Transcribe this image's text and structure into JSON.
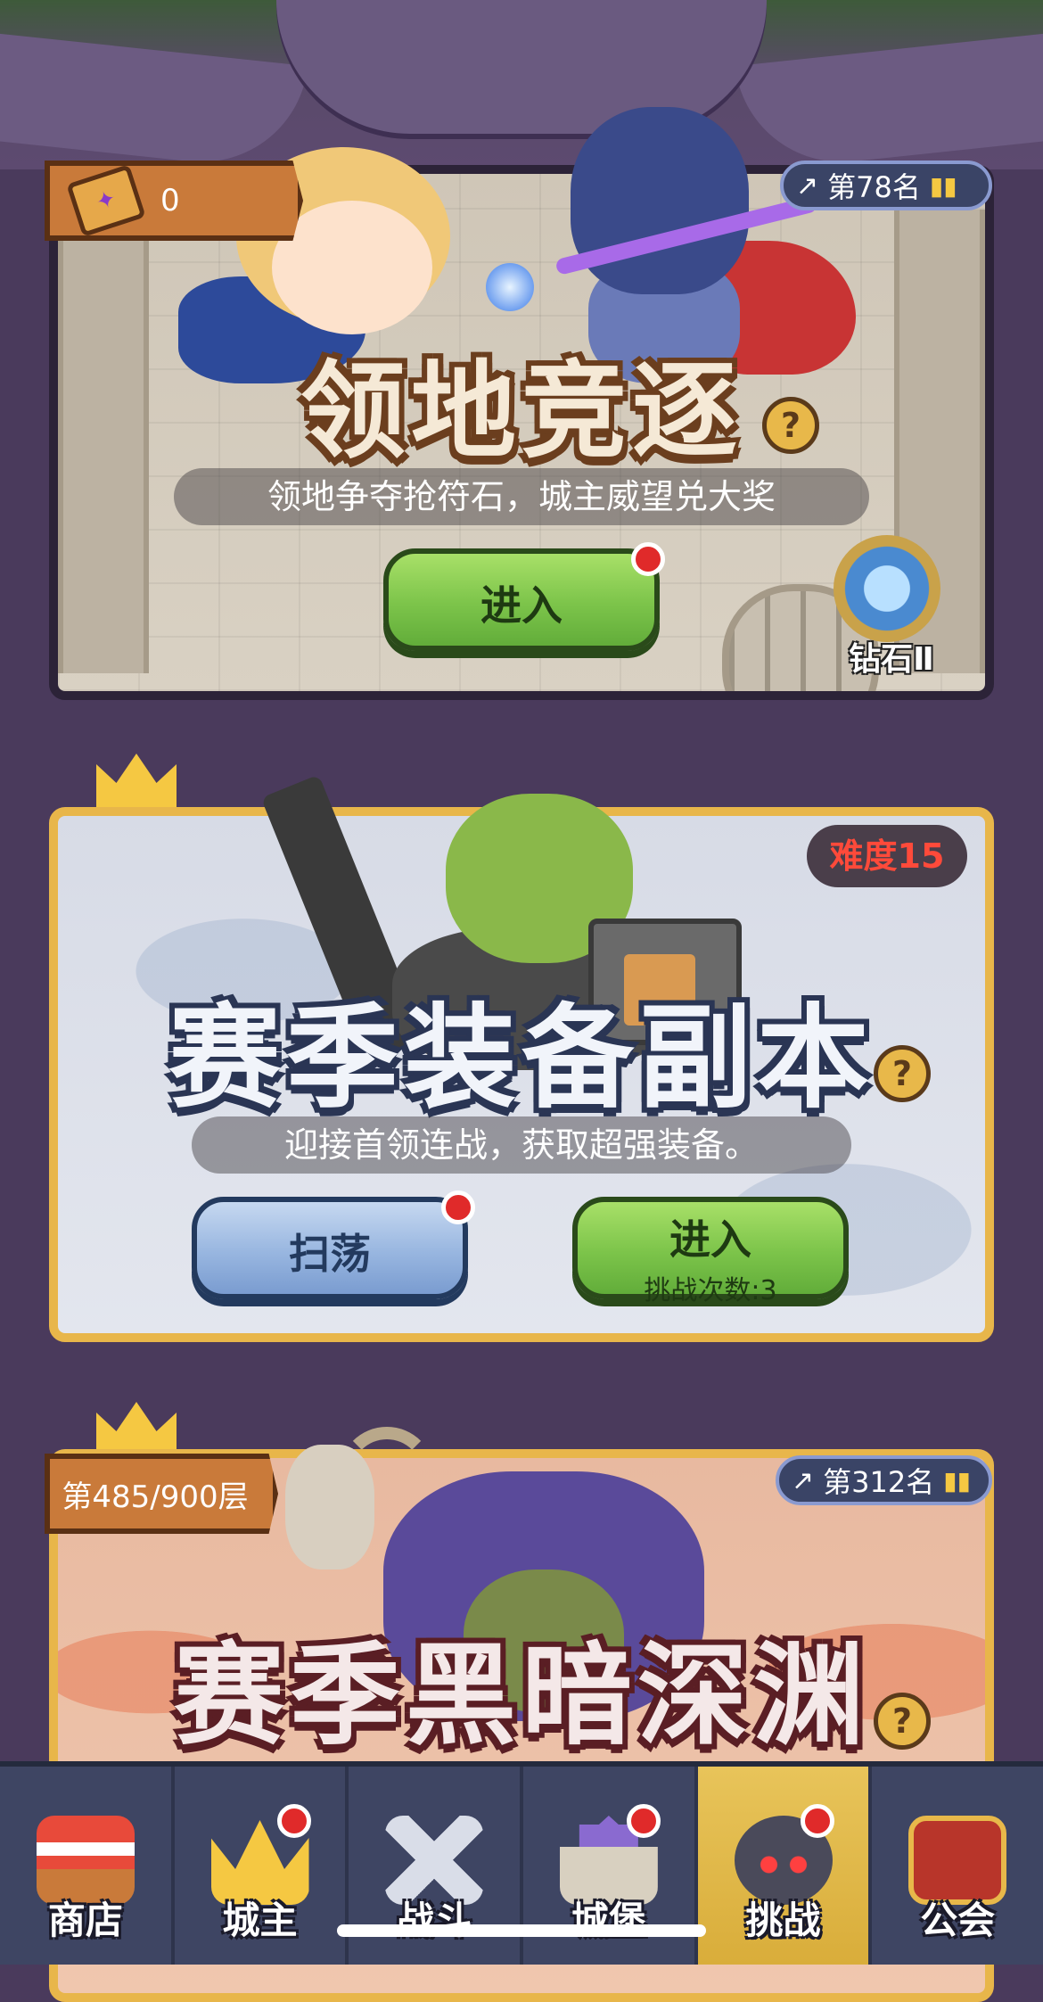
{
  "territory_card": {
    "currency_count": "0",
    "rank": "第78名",
    "title": "领地竞逐",
    "subtitle": "领地争夺抢符石，城主威望兑大奖",
    "enter_label": "进入",
    "tier_label": "钻石Ⅱ"
  },
  "dungeon_card": {
    "difficulty": "难度15",
    "title": "赛季装备副本",
    "subtitle": "迎接首领连战，获取超强装备。",
    "sweep_label": "扫荡",
    "enter_label": "进入",
    "attempts_label": "挑战次数:3"
  },
  "abyss_card": {
    "floor_progress": "第485/900层",
    "rank": "第312名",
    "title": "赛季黑暗深渊"
  },
  "help_symbol": "?",
  "bottom_nav": {
    "items": [
      {
        "label": "商店",
        "icon": "shop-icon",
        "badge": false
      },
      {
        "label": "城主",
        "icon": "crown-icon",
        "badge": true
      },
      {
        "label": "战斗",
        "icon": "crossed-swords-icon",
        "badge": false
      },
      {
        "label": "城堡",
        "icon": "castle-icon",
        "badge": true
      },
      {
        "label": "挑战",
        "icon": "demon-head-icon",
        "badge": true,
        "active": true
      },
      {
        "label": "公会",
        "icon": "guild-banner-icon",
        "badge": false
      }
    ]
  },
  "colors": {
    "active_tab": "#e8c45a",
    "enter_button": "#7cc44a",
    "sweep_button": "#98b6e0",
    "notification_dot": "#e02a2a",
    "difficulty_text": "#ff4a3a"
  }
}
